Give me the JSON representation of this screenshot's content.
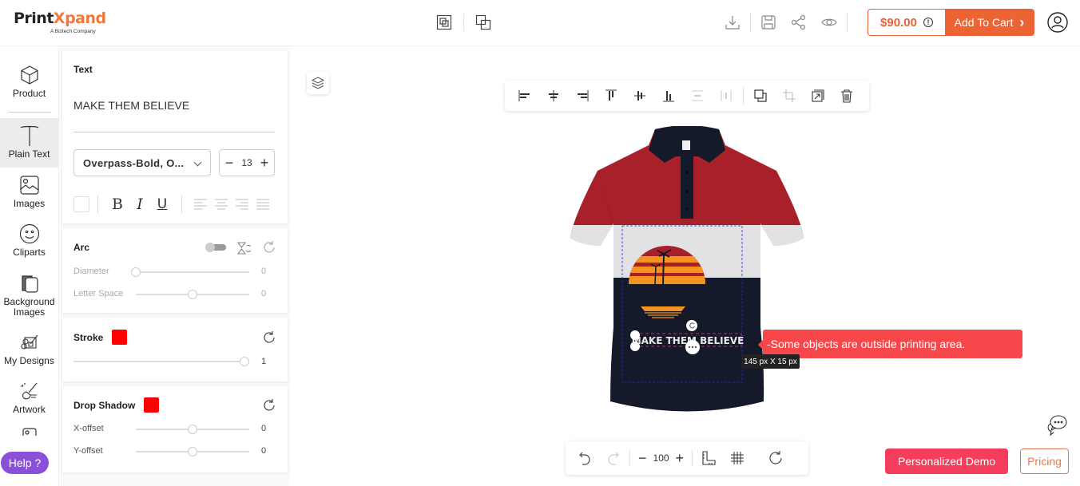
{
  "brand": {
    "name_part1": "Print",
    "name_part2": "Xpand",
    "tagline": "A Biztech Company",
    "accent": "#ec6334"
  },
  "header": {
    "center_icons": [
      "frame-icon",
      "overlap-icon"
    ],
    "right_icons": [
      "download-icon",
      "save-icon",
      "share-icon",
      "preview-icon"
    ],
    "price": "$90.00",
    "price_info_icon": "!",
    "add_to_cart": "Add To Cart",
    "cart_chevron": "›",
    "user_icon": "user-icon"
  },
  "sidebar": {
    "items": [
      {
        "label": "Product",
        "icon": "cube-icon"
      },
      {
        "label": "Plain Text",
        "icon": "text-icon",
        "active": true
      },
      {
        "label": "Images",
        "icon": "image-icon"
      },
      {
        "label": "Cliparts",
        "icon": "smiley-icon"
      },
      {
        "label": "Background Images",
        "icon": "background-icon"
      },
      {
        "label": "My Designs",
        "icon": "designs-icon"
      },
      {
        "label": "Artwork",
        "icon": "artwork-icon"
      }
    ],
    "help": "Help ?"
  },
  "panel": {
    "text": {
      "title": "Text",
      "value": "MAKE THEM BELIEVE",
      "font": "Overpass-Bold, O...",
      "size": "13",
      "minus": "−",
      "plus": "+",
      "bold": "B",
      "italic": "I",
      "underline": "U"
    },
    "arc": {
      "title": "Arc",
      "toggle_on": false,
      "diameter_label": "Diameter",
      "diameter_value": "0",
      "diameter_fraction": 0.0,
      "letter_space_label": "Letter Space",
      "letter_space_value": "0",
      "letter_space_fraction": 0.5
    },
    "stroke": {
      "title": "Stroke",
      "color": "#ff0000",
      "value": "1",
      "fraction": 1.0
    },
    "drop_shadow": {
      "title": "Drop Shadow",
      "color": "#ff0000",
      "x_label": "X-offset",
      "x_value": "0",
      "x_fraction": 0.5,
      "y_label": "Y-offset",
      "y_value": "0",
      "y_fraction": 0.5
    }
  },
  "canvas": {
    "align_tools": [
      "align-left-icon",
      "align-center-h-icon",
      "align-right-icon",
      "align-top-icon",
      "align-middle-icon",
      "align-bottom-icon",
      "distribute-v-icon",
      "distribute-h-icon",
      "duplicate-icon",
      "crop-icon",
      "resize-icon",
      "delete-icon"
    ],
    "design_text": "MAKE THEM BELIEVE",
    "shirt_colors": {
      "top": "#a8212a",
      "middle": "#e2e2e4",
      "bottom": "#151a2b"
    },
    "warning": "-Some objects are outside printing area.",
    "dimensions": "145 px X 15 px",
    "zoom": "100",
    "zoom_minus": "−",
    "zoom_plus": "+"
  },
  "footer": {
    "demo": "Personalized Demo",
    "pricing": "Pricing"
  }
}
